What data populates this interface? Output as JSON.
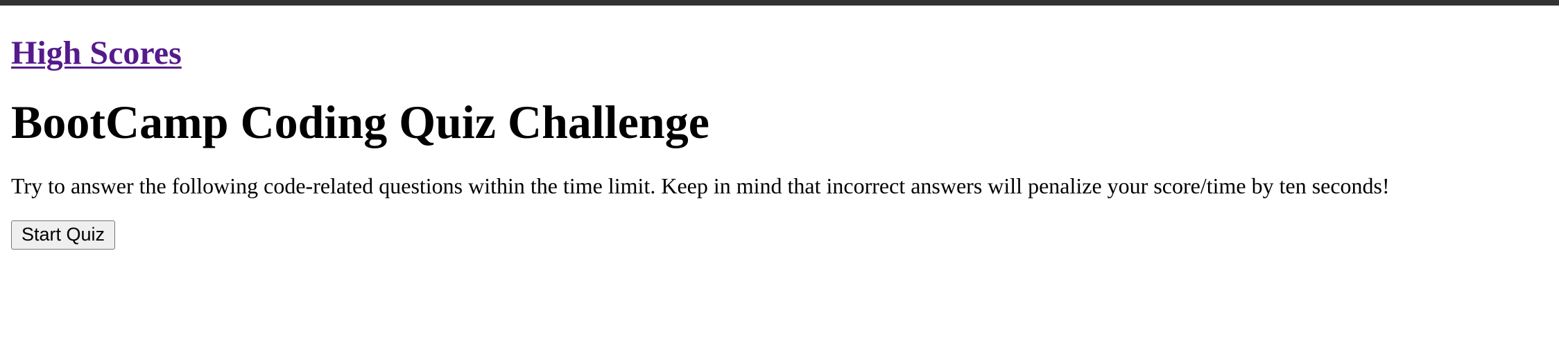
{
  "header": {
    "high_scores_link": "High Scores"
  },
  "main": {
    "title": "BootCamp Coding Quiz Challenge",
    "intro": "Try to answer the following code-related questions within the time limit. Keep in mind that incorrect answers will penalize your score/time by ten seconds!",
    "start_button_label": "Start Quiz"
  },
  "colors": {
    "link": "#551a8b",
    "top_bar": "#333333",
    "button_bg": "#efefef"
  }
}
